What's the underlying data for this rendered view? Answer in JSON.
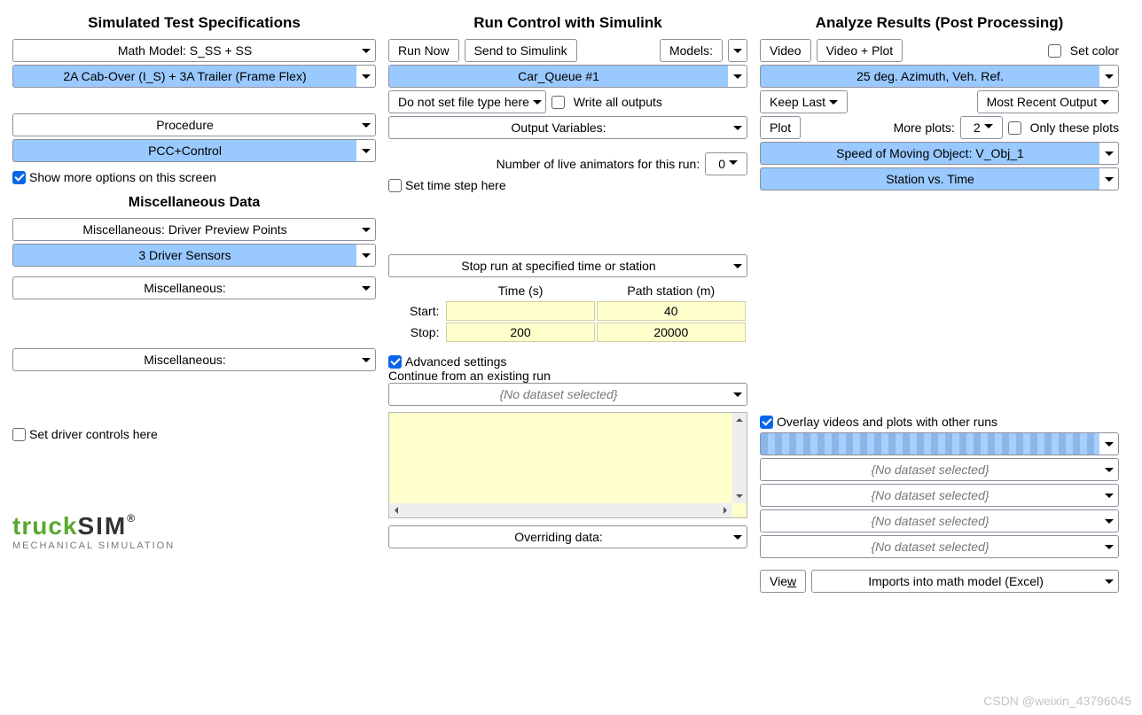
{
  "left": {
    "title": "Simulated Test Specifications",
    "math_model": "Math Model: S_SS + SS",
    "vehicle": "2A Cab-Over (I_S) + 3A Trailer (Frame Flex)",
    "procedure_label": "Procedure",
    "procedure_value": "PCC+Control",
    "show_more": "Show more options on this screen",
    "misc_title": "Miscellaneous Data",
    "misc1": "Miscellaneous: Driver Preview Points",
    "misc1_val": "3 Driver Sensors",
    "misc2": "Miscellaneous:",
    "misc3": "Miscellaneous:",
    "set_driver": "Set driver controls here"
  },
  "center": {
    "title": "Run Control with Simulink",
    "run_now": "Run Now",
    "send": "Send to Simulink",
    "models": "Models:",
    "car_queue": "Car_Queue #1",
    "filetype": "Do not set file type here",
    "write_all": "Write all outputs",
    "output_vars": "Output Variables:",
    "animators_label": "Number of live animators for this run:",
    "animators_value": "0",
    "set_time_step": "Set time step here",
    "stop_option": "Stop run at specified time or station",
    "time_header": "Time (s)",
    "station_header": "Path station (m)",
    "start_label": "Start:",
    "stop_label": "Stop:",
    "start_time": "",
    "start_station": "40",
    "stop_time": "200",
    "stop_station": "20000",
    "advanced": "Advanced settings",
    "continue_label": "Continue from an existing run",
    "no_dataset": "{No dataset selected}",
    "overriding": "Overriding data:"
  },
  "right": {
    "title": "Analyze Results (Post Processing)",
    "video": "Video",
    "video_plot": "Video + Plot",
    "set_color": "Set color",
    "azimuth": "25 deg. Azimuth, Veh. Ref.",
    "keep_last": "Keep Last",
    "most_recent": "Most Recent Output",
    "plot": "Plot",
    "more_plots_label": "More plots:",
    "more_plots_value": "2",
    "only_these": "Only these plots",
    "plot1": "Speed of Moving Object: V_Obj_1",
    "plot2": "Station vs. Time",
    "overlay": "Overlay videos and plots with other runs",
    "no_dataset": "{No dataset selected}",
    "view": "View",
    "imports": "Imports into math model (Excel)"
  },
  "logo": {
    "truck": "truck",
    "sim": "SIM",
    "sub": "MECHANICAL SIMULATION"
  },
  "watermark": "CSDN @weixin_43796045"
}
